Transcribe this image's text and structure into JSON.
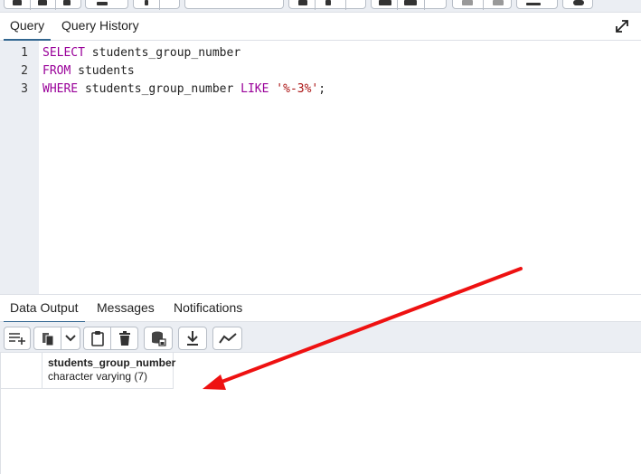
{
  "query_panel": {
    "tabs": [
      {
        "label": "Query",
        "active": true
      },
      {
        "label": "Query History",
        "active": false
      }
    ]
  },
  "editor": {
    "line_numbers": [
      "1",
      "2",
      "3"
    ],
    "lines": [
      [
        {
          "t": "SELECT",
          "kind": "kw"
        },
        {
          "t": " students_group_number",
          "kind": "plain"
        }
      ],
      [
        {
          "t": "FROM",
          "kind": "kw"
        },
        {
          "t": " students",
          "kind": "plain"
        }
      ],
      [
        {
          "t": "WHERE",
          "kind": "kw"
        },
        {
          "t": " students_group_number ",
          "kind": "plain"
        },
        {
          "t": "LIKE",
          "kind": "kw"
        },
        {
          "t": " ",
          "kind": "plain"
        },
        {
          "t": "'%-3%'",
          "kind": "str"
        },
        {
          "t": ";",
          "kind": "plain"
        }
      ]
    ]
  },
  "output_panel": {
    "tabs": [
      {
        "label": "Data Output",
        "active": true
      },
      {
        "label": "Messages",
        "active": false
      },
      {
        "label": "Notifications",
        "active": false
      }
    ],
    "toolbar_icons": [
      "add-row-icon",
      "copy-icon",
      "chevron-down-icon",
      "paste-icon",
      "delete-icon",
      "save-data-icon",
      "download-icon",
      "graph-icon"
    ]
  },
  "grid": {
    "columns": [
      {
        "name": "students_group_number",
        "type": "character varying (7)"
      }
    ],
    "rows": []
  },
  "colors": {
    "keyword": "#990099",
    "string": "#aa1111",
    "accent": "#326690",
    "annotation": "#ee1111"
  }
}
